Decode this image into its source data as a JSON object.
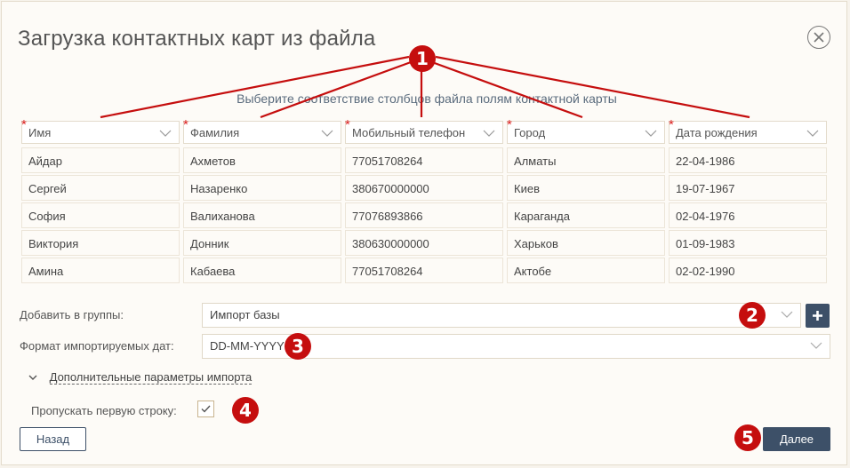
{
  "dialog": {
    "title": "Загрузка контактных карт из файла",
    "subtitle": "Выберите соответствие столбцов файла полям контактной карты"
  },
  "columns": [
    {
      "label": "Имя",
      "required": "*"
    },
    {
      "label": "Фамилия",
      "required": "*"
    },
    {
      "label": "Мобильный телефон",
      "required": "*"
    },
    {
      "label": "Город",
      "required": "*"
    },
    {
      "label": "Дата рождения",
      "required": "*"
    }
  ],
  "rows": [
    [
      "Айдар",
      "Ахметов",
      "77051708264",
      "Алматы",
      "22-04-1986"
    ],
    [
      "Сергей",
      "Назаренко",
      "380670000000",
      "Киев",
      "19-07-1967"
    ],
    [
      "София",
      "Валиханова",
      "77076893866",
      "Караганда",
      "02-04-1976"
    ],
    [
      "Виктория",
      "Донник",
      "380630000000",
      "Харьков",
      "01-09-1983"
    ],
    [
      "Амина",
      "Кабаева",
      "77051708264",
      "Актобе",
      "02-02-1990"
    ]
  ],
  "form": {
    "groups_label": "Добавить в группы:",
    "groups_value": "Импорт базы",
    "date_format_label": "Формат импортируемых дат:",
    "date_format_value": "DD-MM-YYYY",
    "advanced_label": "Дополнительные параметры импорта",
    "skip_first_label": "Пропускать первую строку:",
    "skip_first_checked": true
  },
  "buttons": {
    "back": "Назад",
    "next": "Далее"
  },
  "annotations": [
    "1",
    "2",
    "3",
    "4",
    "5"
  ],
  "colors": {
    "accent": "#3d5068",
    "annotation": "#c50e0e",
    "required": "#dd2222"
  },
  "icons": {
    "close": "close-circle-icon",
    "dropdown": "chevron-down-icon",
    "add": "plus-icon",
    "check": "check-icon"
  }
}
